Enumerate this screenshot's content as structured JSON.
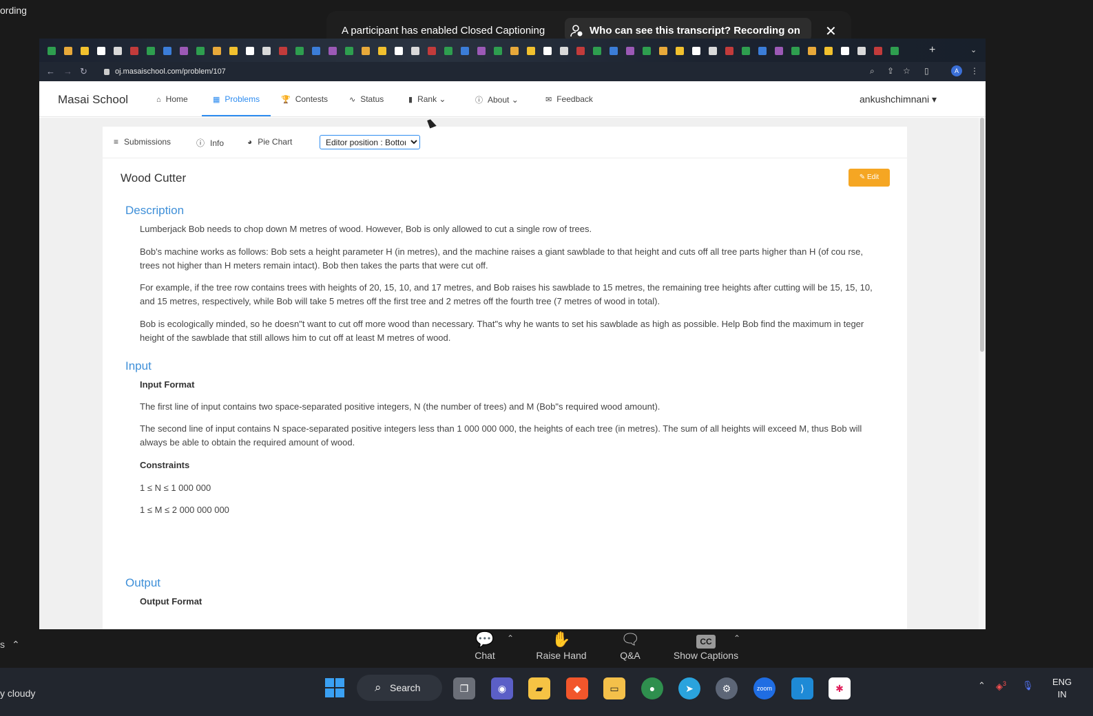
{
  "zoom": {
    "window_title_fragment": "ording",
    "cc_banner_text": "A participant has enabled Closed Captioning",
    "cc_transcript_text": "Who can see this transcript? Recording on",
    "toolbar": {
      "chat": "Chat",
      "raise_hand": "Raise Hand",
      "qa": "Q&A",
      "show_captions": "Show Captions",
      "cc_badge": "CC"
    },
    "left_fragment": "s"
  },
  "browser": {
    "url": "oj.masaischool.com/problem/107",
    "avatar_letter": "A"
  },
  "site": {
    "brand": "Masai School",
    "nav": [
      {
        "label": "Home",
        "icon": "⌂"
      },
      {
        "label": "Problems",
        "icon": "▦"
      },
      {
        "label": "Contests",
        "icon": "🏆"
      },
      {
        "label": "Status",
        "icon": "∿"
      },
      {
        "label": "Rank ⌄",
        "icon": "▮"
      },
      {
        "label": "About ⌄",
        "icon": "ⓘ"
      },
      {
        "label": "Feedback",
        "icon": "✉"
      }
    ],
    "user": "ankushchimnani ▾"
  },
  "problem": {
    "tabs": {
      "submissions": "Submissions",
      "info": "Info",
      "pie_chart": "Pie Chart"
    },
    "editor_position": "Editor position : Bottom",
    "title": "Wood Cutter",
    "edit_label": "✎ Edit",
    "description_heading": "Description",
    "description": [
      "Lumberjack Bob needs to chop down M metres of wood. However, Bob is only allowed to cut a single row of trees.",
      "Bob's machine works as follows: Bob sets a height parameter H (in metres), and the machine raises a giant sawblade to that height and cuts off all tree parts higher than H (of cou rse, trees not higher than H meters remain intact). Bob then takes the parts that were cut off.",
      "For example, if the tree row contains trees with heights of 20, 15, 10, and 17 metres, and Bob raises his sawblade to 15 metres, the remaining tree heights after cutting will be 15, 15, 10, and 15 metres, respectively, while Bob will take 5 metres off the first tree and 2 metres off the fourth tree (7 metres of wood in total).",
      "Bob is ecologically minded, so he doesn\"t want to cut off more wood than necessary. That\"s why he wants to set his sawblade as high as possible. Help Bob find the maximum in teger height of the sawblade that still allows him to cut off at least M metres of wood."
    ],
    "input_heading": "Input",
    "input_format_label": "Input Format",
    "input_lines": [
      "The first line of input contains two space-separated positive integers, N (the number of trees) and M (Bob\"s required wood amount).",
      "The second line of input contains N space-separated positive integers less than 1 000 000 000, the heights of each tree (in metres). The sum of all heights will exceed M, thus Bob will always be able to obtain the required amount of wood."
    ],
    "constraints_label": "Constraints",
    "constraints": [
      "1 ≤ N ≤ 1 000 000",
      "1 ≤ M ≤ 2 000 000 000"
    ],
    "output_heading": "Output",
    "output_format_label": "Output Format"
  },
  "taskbar": {
    "weather": "y cloudy",
    "search": "Search",
    "lang_line1": "ENG",
    "lang_line2": "IN",
    "badge_count": "3"
  },
  "colors": {
    "accent": "#2d8cf0",
    "heading": "#3e8fd8",
    "edit_button": "#f5a623"
  }
}
